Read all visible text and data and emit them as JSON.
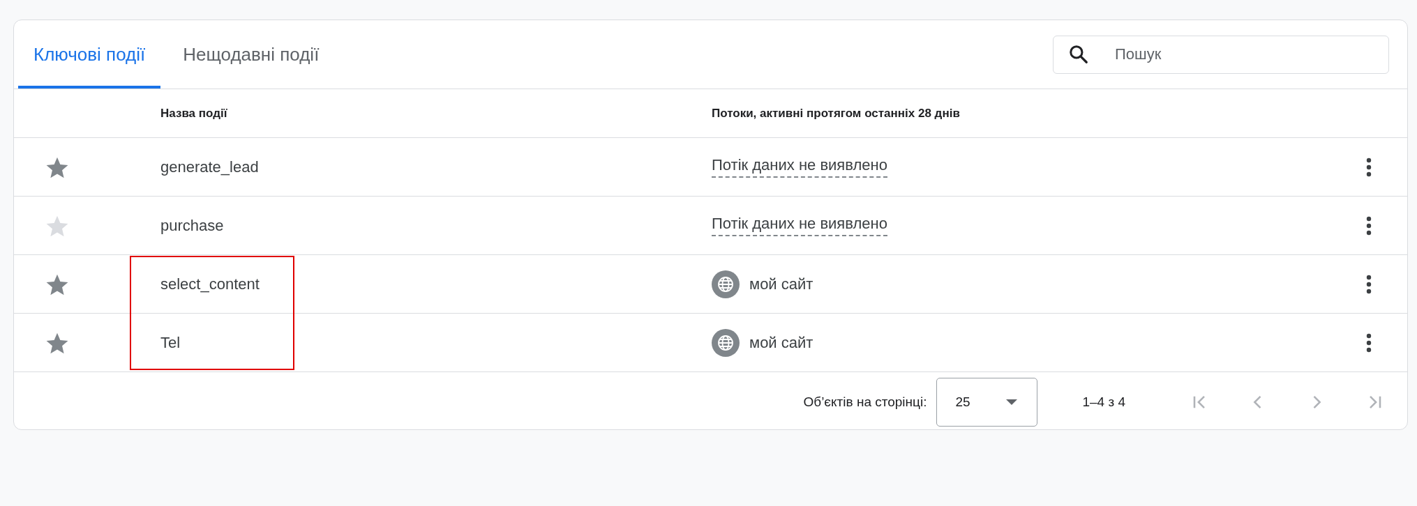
{
  "tabs": [
    {
      "label": "Ключові події",
      "selected": true
    },
    {
      "label": "Нещодавні події",
      "selected": false
    }
  ],
  "search": {
    "placeholder": "Пошук"
  },
  "table": {
    "columns": [
      "Назва події",
      "Потоки, активні протягом останніх 28 днів"
    ],
    "rows": [
      {
        "starred": true,
        "name": "generate_lead",
        "stream": {
          "kind": "none",
          "text": "Потік даних не виявлено"
        }
      },
      {
        "starred": false,
        "name": "purchase",
        "stream": {
          "kind": "none",
          "text": "Потік даних не виявлено"
        }
      },
      {
        "starred": true,
        "name": "select_content",
        "stream": {
          "kind": "web",
          "text": "мой сайт"
        }
      },
      {
        "starred": true,
        "name": "Tel",
        "stream": {
          "kind": "web",
          "text": "мой сайт"
        }
      }
    ]
  },
  "pagination": {
    "per_page_label": "Об’єктів на сторінці:",
    "per_page": "25",
    "range": "1–4 з 4",
    "first_disabled": true,
    "prev_disabled": true,
    "next_disabled": true,
    "last_disabled": true
  }
}
